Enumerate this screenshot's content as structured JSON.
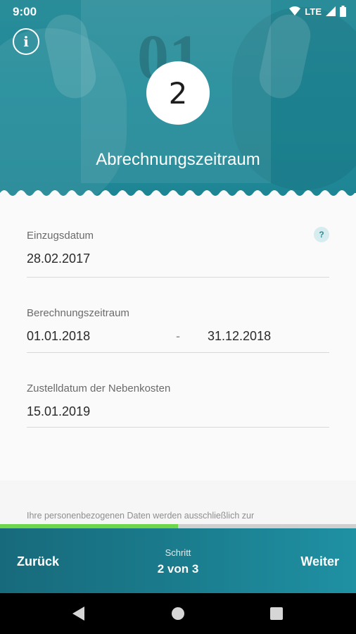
{
  "status_bar": {
    "time": "9:00",
    "network": "LTE"
  },
  "header": {
    "info_icon": "info-icon",
    "step_number": "2",
    "title": "Abrechnungszeitraum",
    "background_text": "01"
  },
  "form": {
    "move_in": {
      "label": "Einzugsdatum",
      "value": "28.02.2017",
      "help": "?"
    },
    "billing_period": {
      "label": "Berechnungszeitraum",
      "from": "01.01.2018",
      "separator": "-",
      "to": "31.12.2018"
    },
    "delivery": {
      "label": "Zustelldatum der Nebenkosten",
      "value": "15.01.2019"
    }
  },
  "privacy_text": "Ihre personenbezogenen Daten werden ausschließlich zur",
  "progress": {
    "fraction": 0.5
  },
  "footer": {
    "back_label": "Zurück",
    "step_label": "Schritt",
    "step_value": "2 von 3",
    "next_label": "Weiter"
  },
  "colors": {
    "accent": "#2a8c99",
    "progress": "#6dd64a",
    "footer": "#1a7c8d"
  }
}
